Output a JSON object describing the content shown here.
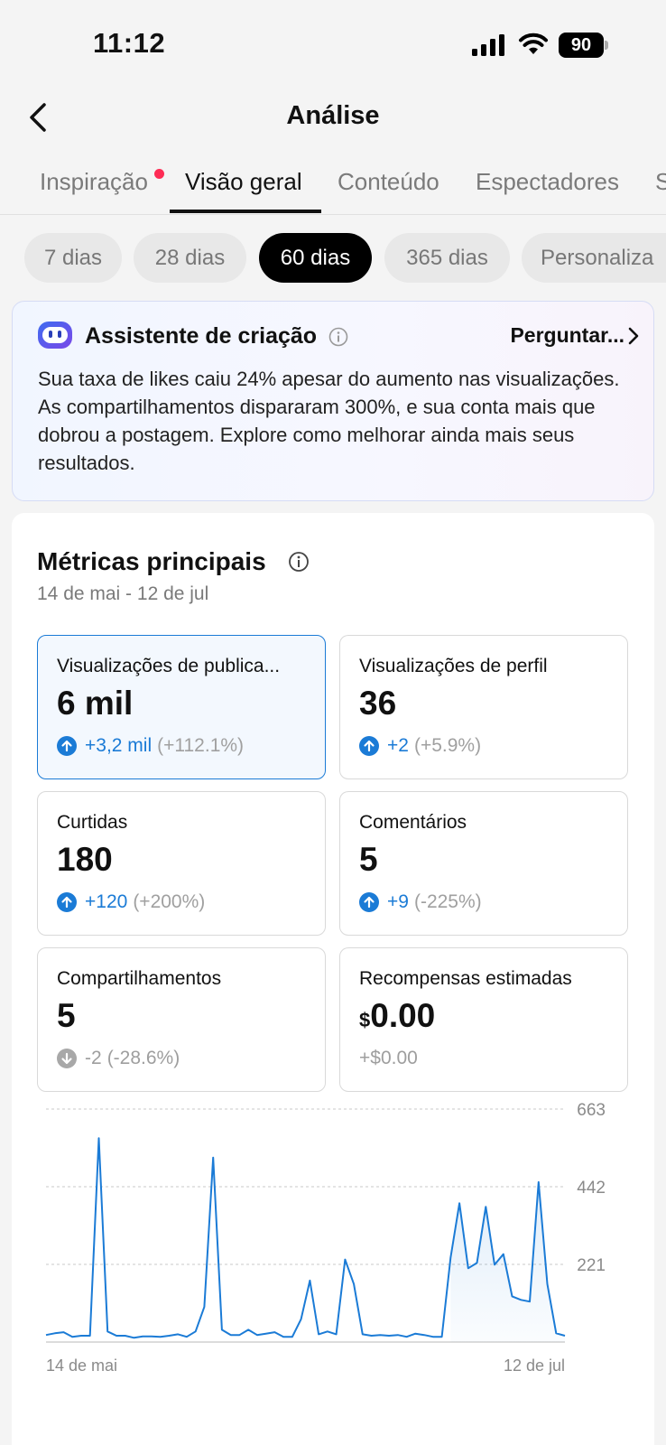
{
  "status_bar": {
    "time": "11:12",
    "battery": "90"
  },
  "nav": {
    "title": "Análise"
  },
  "tabs": [
    {
      "label": "Inspiração",
      "active": false,
      "has_dot": true
    },
    {
      "label": "Visão geral",
      "active": true
    },
    {
      "label": "Conteúdo",
      "active": false
    },
    {
      "label": "Espectadores",
      "active": false
    },
    {
      "label": "S",
      "active": false
    }
  ],
  "periods": [
    {
      "label": "7 dias",
      "active": false
    },
    {
      "label": "28 dias",
      "active": false
    },
    {
      "label": "60 dias",
      "active": true
    },
    {
      "label": "365 dias",
      "active": false
    },
    {
      "label": "Personaliza",
      "active": false
    }
  ],
  "assistant": {
    "title": "Assistente de criação",
    "ask_label": "Perguntar...",
    "message": "Sua taxa de likes caiu 24% apesar do aumento nas visualizações. As compartilhamentos dispararam 300%, e sua conta mais que dobrou a postagem. Explore como melhorar ainda mais seus resultados."
  },
  "metrics": {
    "title": "Métricas principais",
    "range": "14 de mai - 12 de jul",
    "tiles": [
      {
        "label": "Visualizações de publica...",
        "value": "6 mil",
        "delta": "+3,2 mil",
        "pct": "(+112.1%)",
        "trend": "up",
        "selected": true
      },
      {
        "label": "Visualizações de perfil",
        "value": "36",
        "delta": "+2",
        "pct": "(+5.9%)",
        "trend": "up"
      },
      {
        "label": "Curtidas",
        "value": "180",
        "delta": "+120",
        "pct": "(+200%)",
        "trend": "up"
      },
      {
        "label": "Comentários",
        "value": "5",
        "delta": "+9",
        "pct": "(-225%)",
        "trend": "up"
      },
      {
        "label": "Compartilhamentos",
        "value": "5",
        "delta": "-2",
        "pct": "(-28.6%)",
        "trend": "down"
      },
      {
        "label": "Recompensas estimadas",
        "currency": "$",
        "value": "0.00",
        "delta": "+$0.00",
        "pct": "",
        "trend": "none"
      }
    ]
  },
  "chart_data": {
    "type": "line",
    "y_ticks": [
      663,
      442,
      221
    ],
    "ylim": [
      0,
      663
    ],
    "x_labels": [
      "14 de mai",
      "12 de jul"
    ],
    "grid": true,
    "color": "#1b7bd6",
    "values": [
      20,
      25,
      28,
      15,
      18,
      18,
      580,
      30,
      18,
      18,
      12,
      16,
      16,
      15,
      18,
      22,
      15,
      30,
      100,
      525,
      35,
      20,
      20,
      35,
      20,
      24,
      28,
      15,
      15,
      65,
      175,
      22,
      30,
      22,
      235,
      165,
      22,
      18,
      20,
      18,
      20,
      15,
      24,
      20,
      15,
      15,
      240,
      395,
      210,
      225,
      385,
      220,
      250,
      130,
      120,
      115,
      455,
      165,
      25,
      18
    ]
  }
}
